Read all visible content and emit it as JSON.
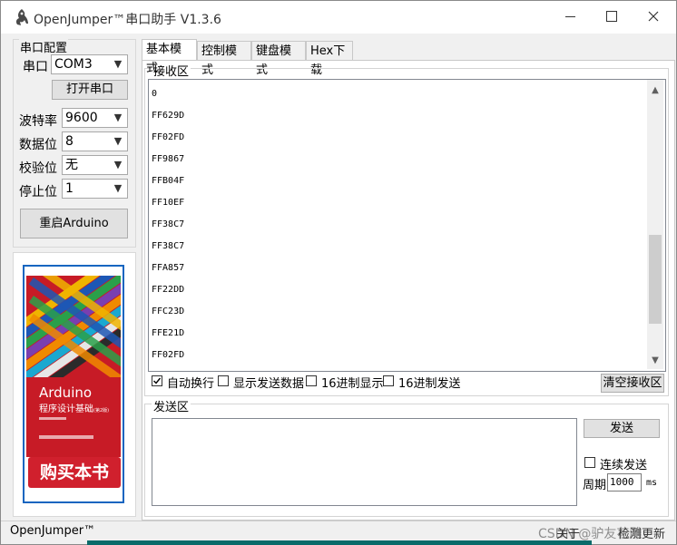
{
  "window": {
    "title": "OpenJumper™串口助手  V1.3.6"
  },
  "serial": {
    "group_title": "串口配置",
    "port_label": "串口",
    "port_value": "COM3",
    "open_button": "打开串口",
    "baud_label": "波特率",
    "baud_value": "9600",
    "databits_label": "数据位",
    "databits_value": "8",
    "parity_label": "校验位",
    "parity_value": "无",
    "stopbits_label": "停止位",
    "stopbits_value": "1",
    "restart_button": "重启Arduino"
  },
  "ad": {
    "book_title": "Arduino",
    "book_subtitle": "程序设计基础",
    "edition": "(第2版)",
    "buy_label": "购买本书"
  },
  "tabs": [
    "基本模式",
    "控制模式",
    "键盘模式",
    "Hex下载"
  ],
  "receive": {
    "group_title": "接收区",
    "lines": [
      "0",
      "FF629D",
      "FF02FD",
      "FF9867",
      "FFB04F",
      "FF10EF",
      "FF38C7",
      "FF38C7",
      "FFA857",
      "FF22DD",
      "FFC23D",
      "FFE21D",
      "FF02FD"
    ],
    "opt_auto_wrap": "自动换行",
    "opt_show_sent": "显示发送数据",
    "opt_hex_display": "16进制显示",
    "opt_hex_send": "16进制发送",
    "clear_button": "清空接收区"
  },
  "send": {
    "group_title": "发送区",
    "send_button": "发送",
    "continuous_label": "连续发送",
    "period_label": "周期",
    "period_value": "1000",
    "period_unit": "ms"
  },
  "status": {
    "left": "OpenJumper™",
    "right_about": "关于",
    "right_update": "检测更新",
    "watermark": "CSDN @驴友花雕"
  },
  "colors": {
    "accent_blue": "#1565c0",
    "book_red": "#c71b26",
    "buy_red": "#d0202d"
  }
}
